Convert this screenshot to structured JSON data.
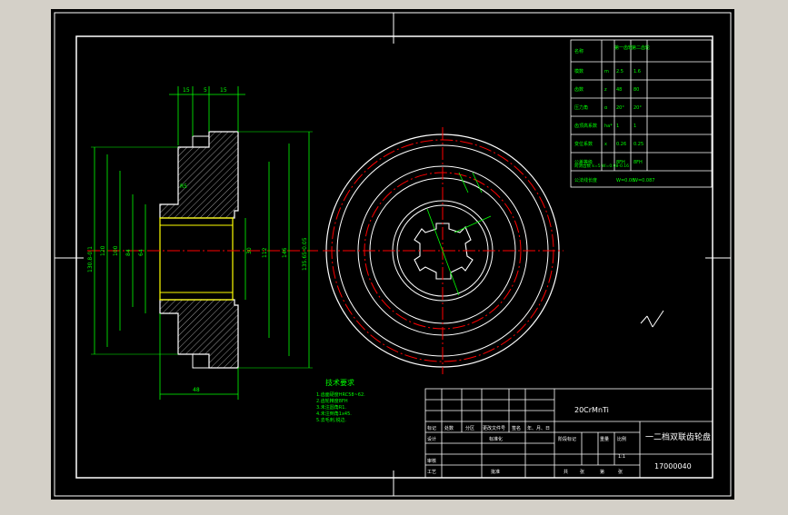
{
  "drawing": {
    "material": "20CrMnTi",
    "part_name": "一二档双联齿轮盘",
    "drawing_number": "17000040",
    "tech_requirements_title": "技术要求",
    "tech_requirements": [
      "1.齿面硬度HRC58~62.",
      "2.齿轮精度8FH",
      "3.未注圆角R1.",
      "4.未注倒角1x45.",
      "5.去毛刺,锐边."
    ]
  },
  "dimensions": {
    "top": [
      "15",
      "5",
      "15"
    ],
    "bottom_width": "48",
    "left": [
      "130.8-0.1",
      "120",
      "100",
      "84",
      "64"
    ],
    "right": [
      "30",
      "112",
      "146",
      "135.65-0.05"
    ],
    "detail_radius": "R5",
    "ratio": "1:1"
  },
  "gear_table": {
    "header": [
      "名称",
      "第一齿轮",
      "第二齿轮"
    ],
    "rows": [
      [
        "模数",
        "m",
        "2.5",
        "1.6"
      ],
      [
        "齿数",
        "z",
        "48",
        "80"
      ],
      [
        "压力角",
        "α",
        "20°",
        "20°"
      ],
      [
        "齿顶高系数",
        "ha*",
        "1",
        "1"
      ],
      [
        "变位系数",
        "x",
        "0.26",
        "0.25"
      ],
      [
        "公差等级",
        "",
        "8FH",
        "8FH"
      ],
      [
        "公法线长度",
        "",
        "W=0.08",
        "W=0.087"
      ]
    ],
    "footnote": "跨测齿数 k=5 W=0.08-0.16"
  },
  "title_block": {
    "header_cells": [
      "标记",
      "处数",
      "分区",
      "更改文件号",
      "签名",
      "年、月、日"
    ],
    "roles": [
      "设计",
      "标准化",
      "审核",
      "工艺",
      "批准"
    ],
    "stage_labels": [
      "阶段标记",
      "重量",
      "比例"
    ],
    "sheet_labels": [
      "共",
      "张",
      "第",
      "张"
    ]
  }
}
